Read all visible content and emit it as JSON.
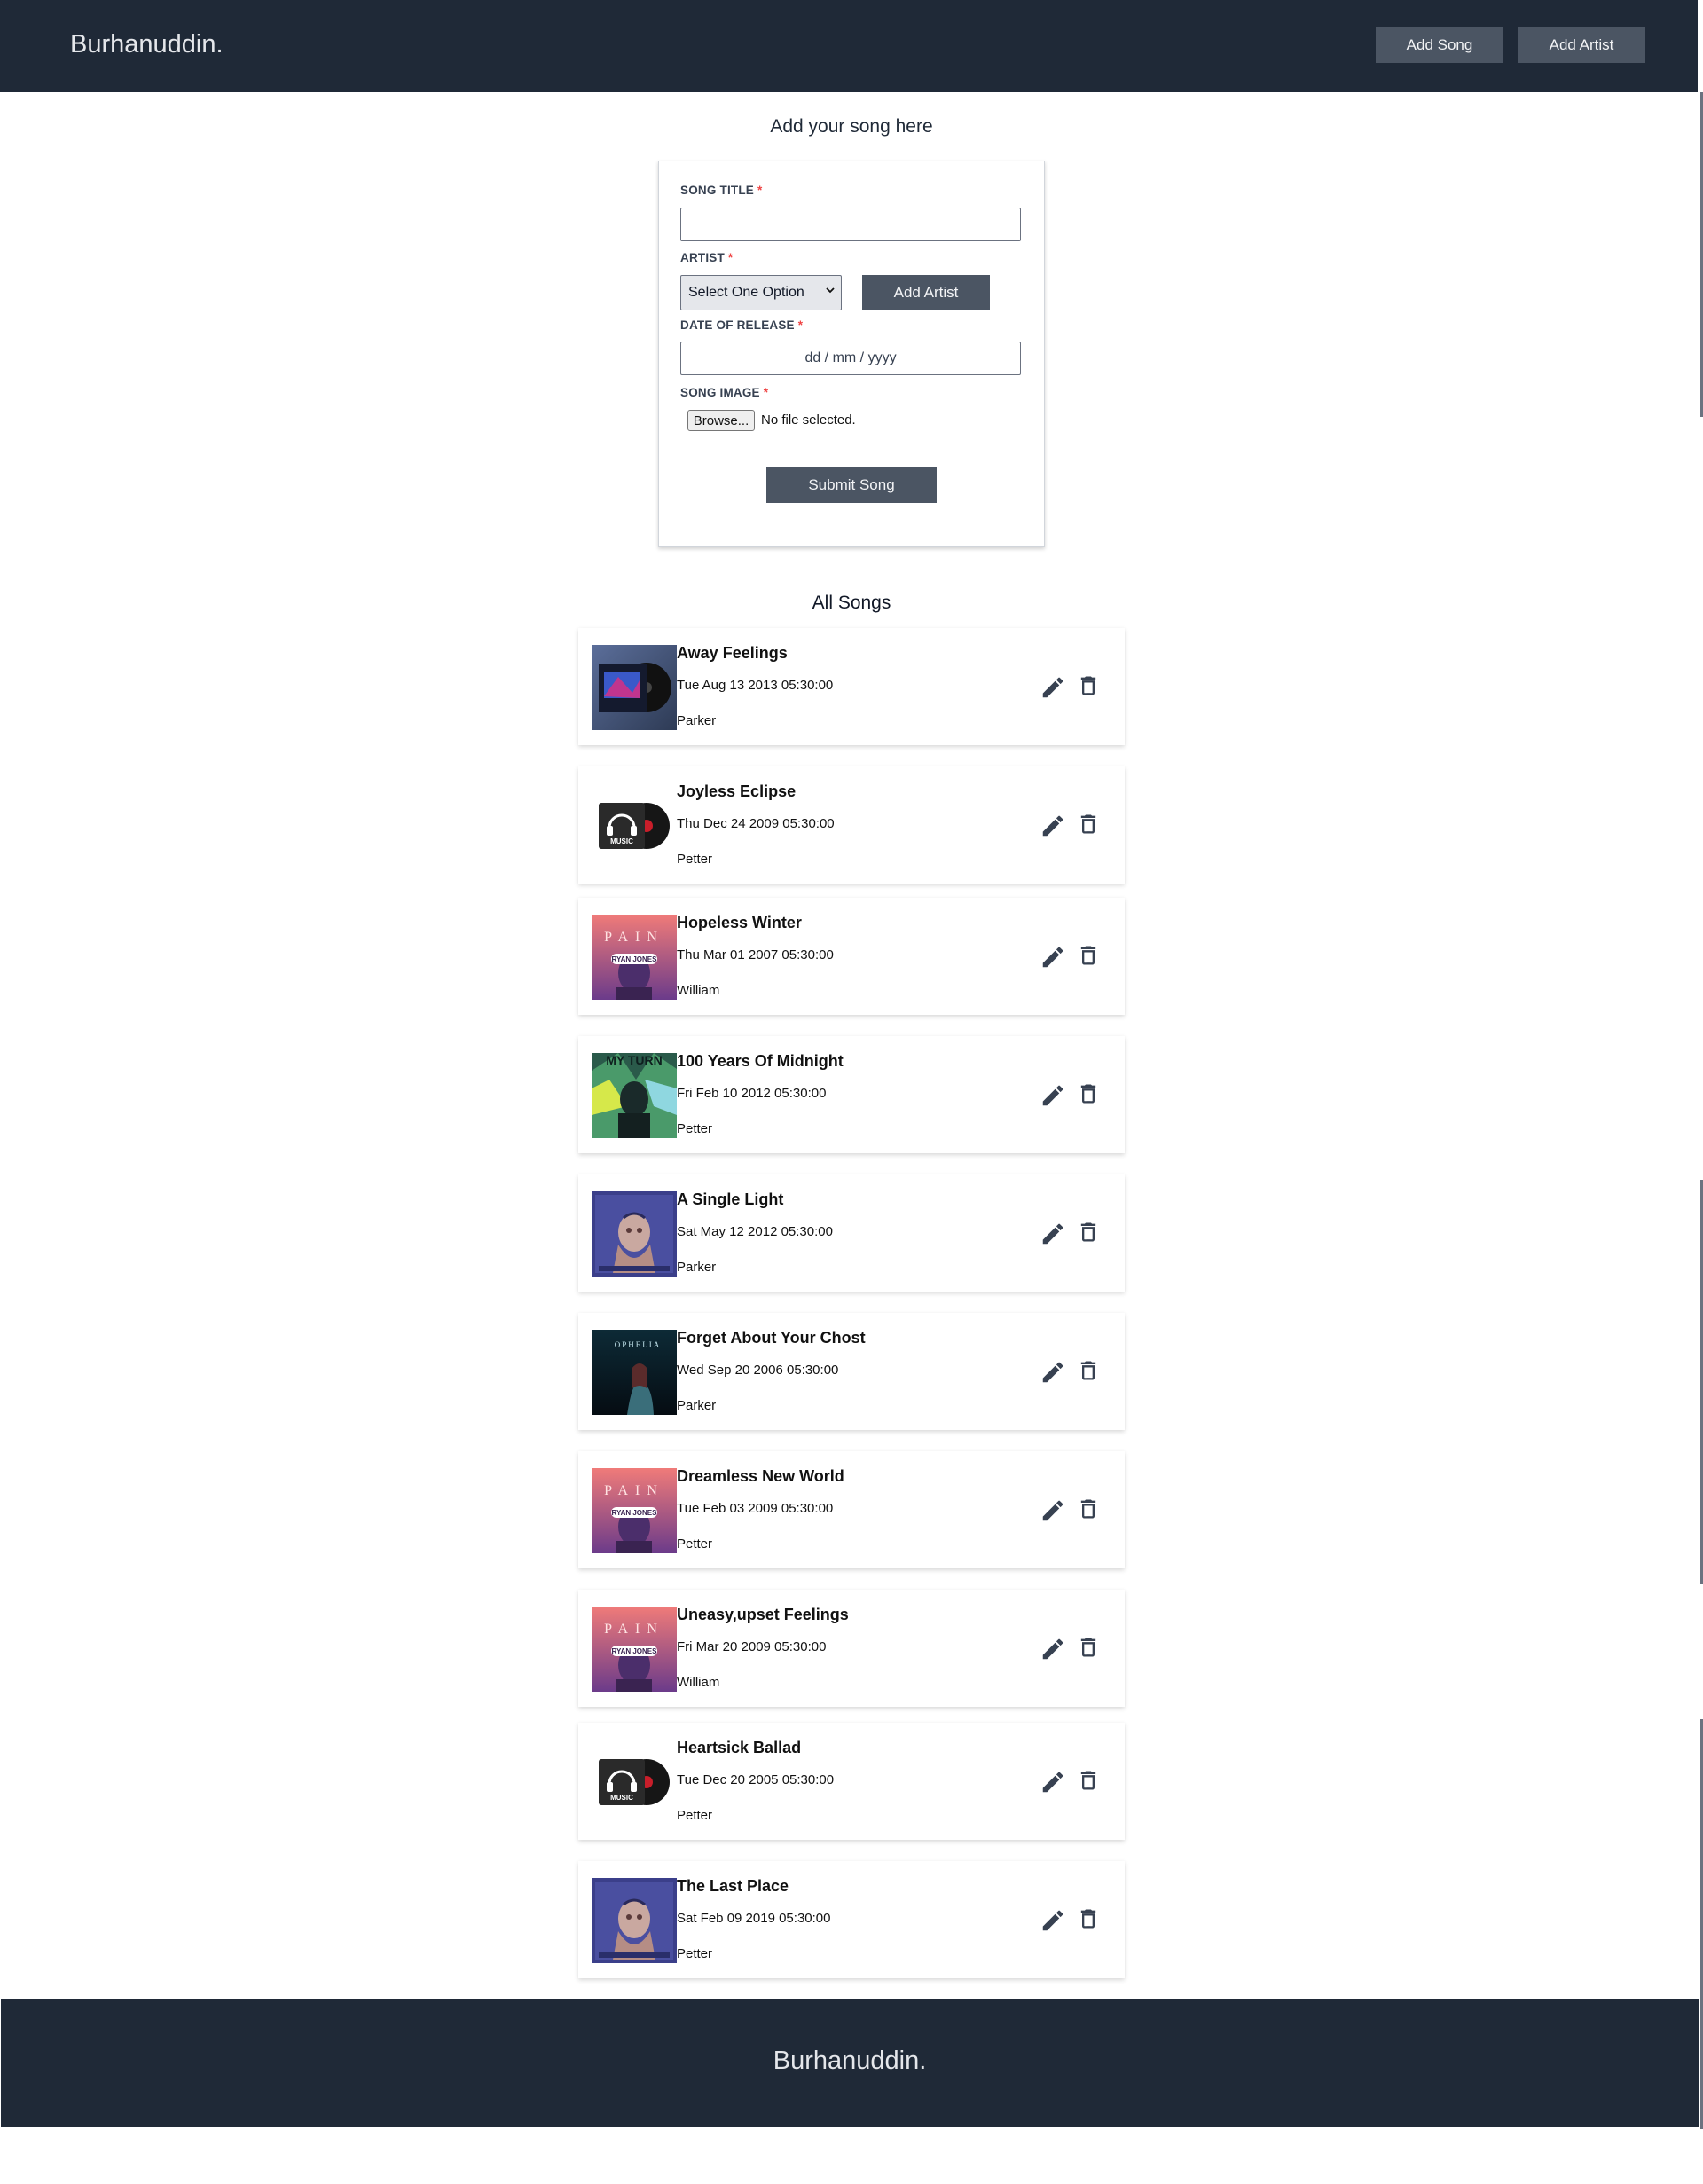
{
  "header": {
    "brand": "Burhanuddin.",
    "add_song_label": "Add Song",
    "add_artist_label": "Add Artist"
  },
  "form": {
    "heading": "Add your song here",
    "title_label": "SONG TITLE",
    "artist_label": "ARTIST",
    "date_label": "DATE OF RELEASE",
    "image_label": "SONG IMAGE",
    "required_mark": "*",
    "title_value": "",
    "artist_selected": "Select One Option",
    "add_artist_label": "Add Artist",
    "date_placeholder": "dd / mm / yyyy",
    "browse_label": "Browse...",
    "file_status": "No file selected.",
    "submit_label": "Submit Song"
  },
  "songs_heading": "All Songs",
  "songs": [
    {
      "title": "Away Feelings",
      "date": "Tue Aug 13 2013 05:30:00",
      "artist": "Parker",
      "cover": "vinyl-dark-blue"
    },
    {
      "title": "Joyless Eclipse",
      "date": "Thu Dec 24 2009 05:30:00",
      "artist": "Petter",
      "cover": "music-record"
    },
    {
      "title": "Hopeless Winter",
      "date": "Thu Mar 01 2007 05:30:00",
      "artist": "William",
      "cover": "pain-ryan-jones"
    },
    {
      "title": "100 Years Of Midnight",
      "date": "Fri Feb 10 2012 05:30:00",
      "artist": "Petter",
      "cover": "my-turn"
    },
    {
      "title": "A Single Light",
      "date": "Sat May 12 2012 05:30:00",
      "artist": "Parker",
      "cover": "tattoo-portrait"
    },
    {
      "title": "Forget About Your Chost",
      "date": "Wed Sep 20 2006 05:30:00",
      "artist": "Parker",
      "cover": "ophelia"
    },
    {
      "title": "Dreamless New World",
      "date": "Tue Feb 03 2009 05:30:00",
      "artist": "Petter",
      "cover": "pain-ryan-jones"
    },
    {
      "title": "Uneasy,upset Feelings",
      "date": "Fri Mar 20 2009 05:30:00",
      "artist": "William",
      "cover": "pain-ryan-jones"
    },
    {
      "title": "Heartsick Ballad",
      "date": "Tue Dec 20 2005 05:30:00",
      "artist": "Petter",
      "cover": "music-record"
    },
    {
      "title": "The Last Place",
      "date": "Sat Feb 09 2019 05:30:00",
      "artist": "Petter",
      "cover": "tattoo-portrait"
    }
  ],
  "cover_text": {
    "pain": "PAIN",
    "ryan_jones": "RYAN JONES",
    "music": "MUSIC",
    "my_turn": "MY TURN",
    "ophelia": "OPHELIA"
  },
  "footer": {
    "brand": "Burhanuddin."
  },
  "colors": {
    "header_bg": "#1f2937",
    "button_bg": "#4b5563",
    "required": "#ef4444"
  }
}
